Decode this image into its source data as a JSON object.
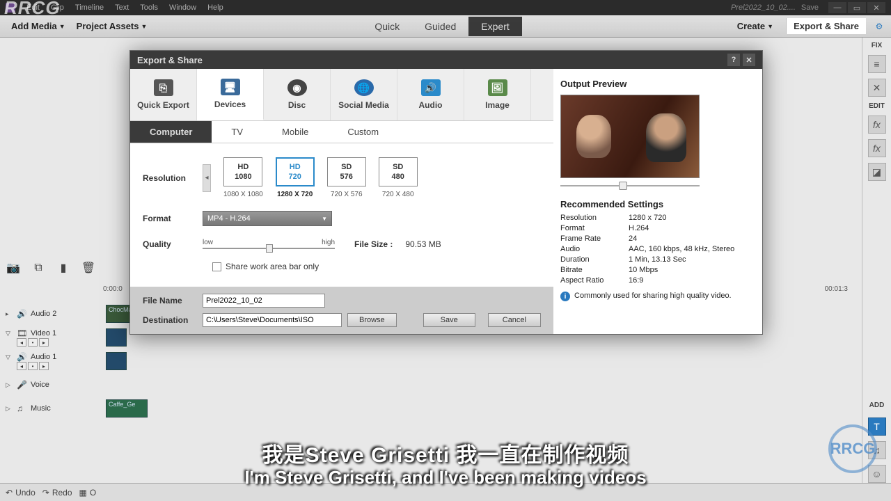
{
  "menubar": {
    "items": [
      "Edit",
      "Clip",
      "Timeline",
      "Text",
      "Tools",
      "Window",
      "Help"
    ],
    "filename": "Prel2022_10_02....",
    "save": "Save"
  },
  "toolbar": {
    "add_media": "Add Media",
    "project_assets": "Project Assets",
    "quick": "Quick",
    "guided": "Guided",
    "expert": "Expert",
    "create": "Create",
    "export_share": "Export & Share"
  },
  "right_sidebar": {
    "fix": "FIX",
    "edit": "EDIT",
    "add": "ADD"
  },
  "dialog": {
    "title": "Export & Share",
    "cats": {
      "quick": "Quick Export",
      "devices": "Devices",
      "disc": "Disc",
      "social": "Social Media",
      "audio": "Audio",
      "image": "Image"
    },
    "subs": {
      "computer": "Computer",
      "tv": "TV",
      "mobile": "Mobile",
      "custom": "Custom"
    },
    "labels": {
      "resolution": "Resolution",
      "format": "Format",
      "quality": "Quality",
      "file_size": "File Size :",
      "share_chk": "Share work area bar only",
      "file_name": "File Name",
      "destination": "Destination",
      "browse": "Browse",
      "save": "Save",
      "cancel": "Cancel"
    },
    "res": [
      {
        "t": "HD",
        "v": "1080",
        "dim": "1080 X 1080"
      },
      {
        "t": "HD",
        "v": "720",
        "dim": "1280 X 720",
        "sel": true
      },
      {
        "t": "SD",
        "v": "576",
        "dim": "720 X 576"
      },
      {
        "t": "SD",
        "v": "480",
        "dim": "720 X 480"
      }
    ],
    "format_value": "MP4 - H.264",
    "quality_low": "low",
    "quality_high": "high",
    "file_size_value": "90.53 MB",
    "file_name_value": "Prel2022_10_02",
    "destination_value": "C:\\Users\\Steve\\Documents\\ISO",
    "preview": {
      "title": "Output Preview",
      "rec_title": "Recommended Settings"
    },
    "rec": [
      {
        "k": "Resolution",
        "v": "1280 x 720"
      },
      {
        "k": "Format",
        "v": "H.264"
      },
      {
        "k": "Frame Rate",
        "v": "24"
      },
      {
        "k": "Audio",
        "v": "AAC, 160 kbps, 48 kHz, Stereo"
      },
      {
        "k": "Duration",
        "v": "1 Min, 13.13 Sec"
      },
      {
        "k": "Bitrate",
        "v": "10 Mbps"
      },
      {
        "k": "Aspect Ratio",
        "v": "16:9"
      }
    ],
    "info": "Commonly used for sharing high quality video."
  },
  "timeline": {
    "tracks": [
      "Audio 2",
      "Video 1",
      "Audio 1",
      "Voice",
      "Music"
    ],
    "clip1": "ChocMa",
    "clip2": "Caffe_Ge",
    "time_left": "0:00:0",
    "time_right": "00:01:3"
  },
  "bottombar": {
    "undo": "Undo",
    "redo": "Redo",
    "org": "O"
  },
  "subs": {
    "cn": "我是Steve Grisetti 我一直在制作视频",
    "en": "I'm Steve Grisetti, and I've been making videos"
  },
  "wm": {
    "tl": "RRCG",
    "br": "RRCG"
  }
}
